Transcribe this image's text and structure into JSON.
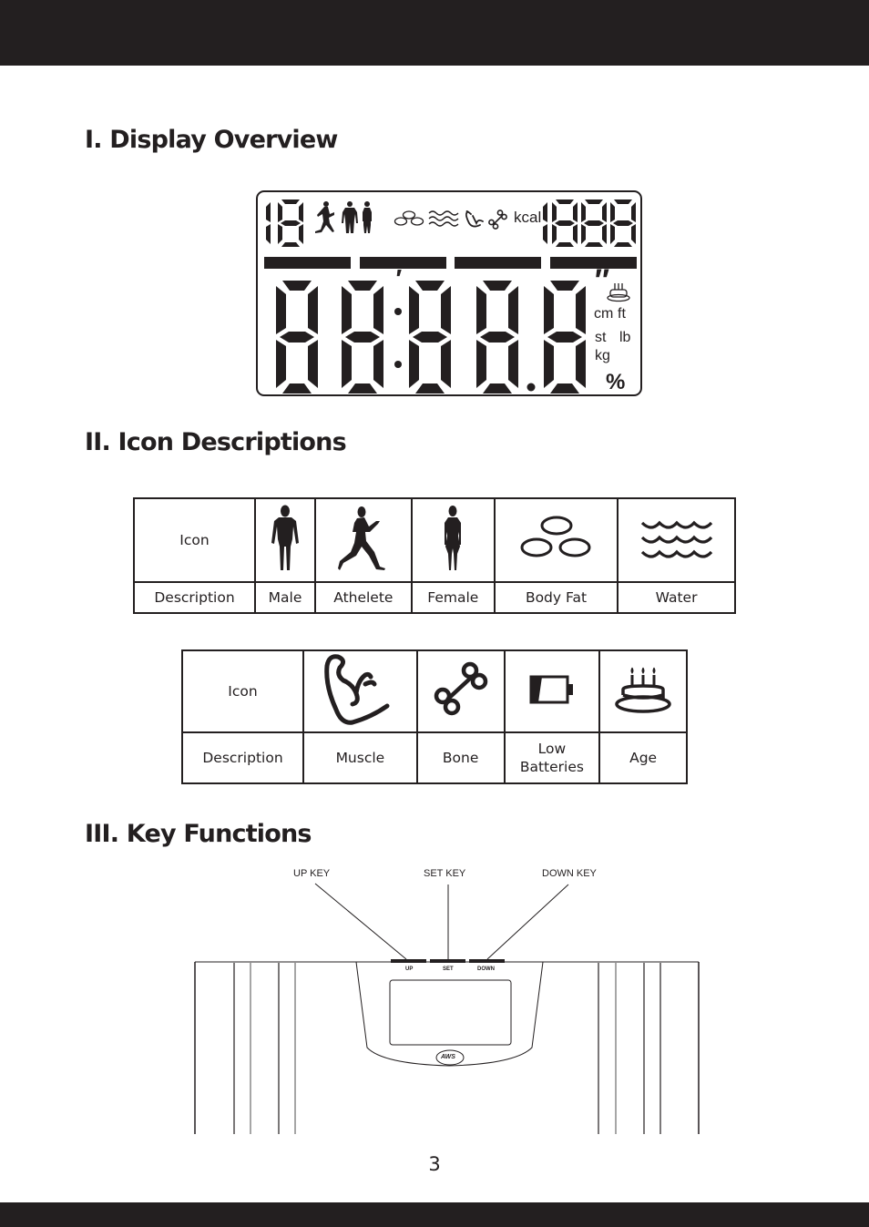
{
  "sections": {
    "display_overview": "I. Display Overview",
    "icon_descriptions": "II. Icon Descriptions",
    "key_functions": "III. Key Functions"
  },
  "lcd": {
    "top_left_digits": "18",
    "top_right_digits": "1888",
    "main_digits": "88:88.8",
    "icons": [
      "athlete-icon",
      "male-icon",
      "female-icon",
      "body-fat-icon",
      "water-icon",
      "muscle-icon",
      "bone-icon",
      "age-icon"
    ],
    "kcal_label": "kcal",
    "minute_mark": "′",
    "second_mark": "″",
    "units": {
      "cm": "cm",
      "ft": "ft",
      "st": "st",
      "lb": "lb",
      "kg": "kg",
      "percent": "%"
    },
    "bar_segments": 4
  },
  "icon_table_1": {
    "row_labels": {
      "icon": "Icon",
      "description": "Description"
    },
    "items": [
      {
        "icon": "male-icon",
        "label": "Male"
      },
      {
        "icon": "athlete-icon",
        "label": "Athelete"
      },
      {
        "icon": "female-icon",
        "label": "Female"
      },
      {
        "icon": "body-fat-icon",
        "label": "Body Fat"
      },
      {
        "icon": "water-icon",
        "label": "Water"
      }
    ]
  },
  "icon_table_2": {
    "row_labels": {
      "icon": "Icon",
      "description": "Description"
    },
    "items": [
      {
        "icon": "muscle-icon",
        "label": "Muscle"
      },
      {
        "icon": "bone-icon",
        "label": "Bone"
      },
      {
        "icon": "low-battery-icon",
        "label_line1": "Low",
        "label_line2": "Batteries"
      },
      {
        "icon": "age-icon",
        "label": "Age"
      }
    ]
  },
  "key_diagram": {
    "callouts": {
      "up": "UP KEY",
      "set": "SET KEY",
      "down": "DOWN KEY"
    },
    "button_labels": {
      "up": "UP",
      "set": "SET",
      "down": "DOWN"
    },
    "logo": "AWS"
  },
  "page_number": "3"
}
